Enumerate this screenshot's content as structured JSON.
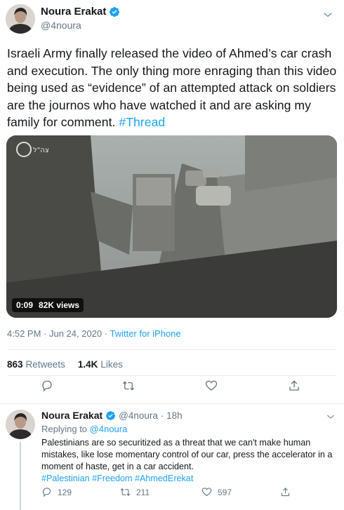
{
  "tweet": {
    "author": {
      "name": "Noura Erakat",
      "handle": "@4noura"
    },
    "text": "Israeli Army finally released the video  of Ahmed’s car crash and execution. The only thing more enraging than this video being used as “evidence” of an attempted attack on soldiers are the journos who have watched it and are asking my family for comment. ",
    "hashtag": "#Thread",
    "video": {
      "duration": "0:09",
      "views": "82K views"
    },
    "timestamp": "4:52 PM · Jun 24, 2020",
    "separator": " · ",
    "source": "Twitter for iPhone",
    "retweets": {
      "count": "863",
      "label": "Retweets"
    },
    "likes": {
      "count": "1.4K",
      "label": "Likes"
    }
  },
  "reply": {
    "author": {
      "name": "Noura Erakat",
      "handle": "@4noura",
      "time": "· 18h"
    },
    "replying_label": "Replying to ",
    "replying_to": "@4noura",
    "text": "Palestinians are so securitized as a threat that we can't make human mistakes, like lose momentary control of our car, press the accelerator in a moment of haste, get in a car accident.",
    "hashtags": "#Palestinian #Freedom #AhmedErekat",
    "counts": {
      "replies": "129",
      "retweets": "211",
      "likes": "597"
    }
  },
  "colors": {
    "accent": "#1da1f2",
    "muted": "#657786",
    "text": "#14171a"
  },
  "icons": [
    "verified-badge-icon",
    "chevron-down-icon",
    "reply-icon",
    "retweet-icon",
    "like-icon",
    "share-icon"
  ]
}
